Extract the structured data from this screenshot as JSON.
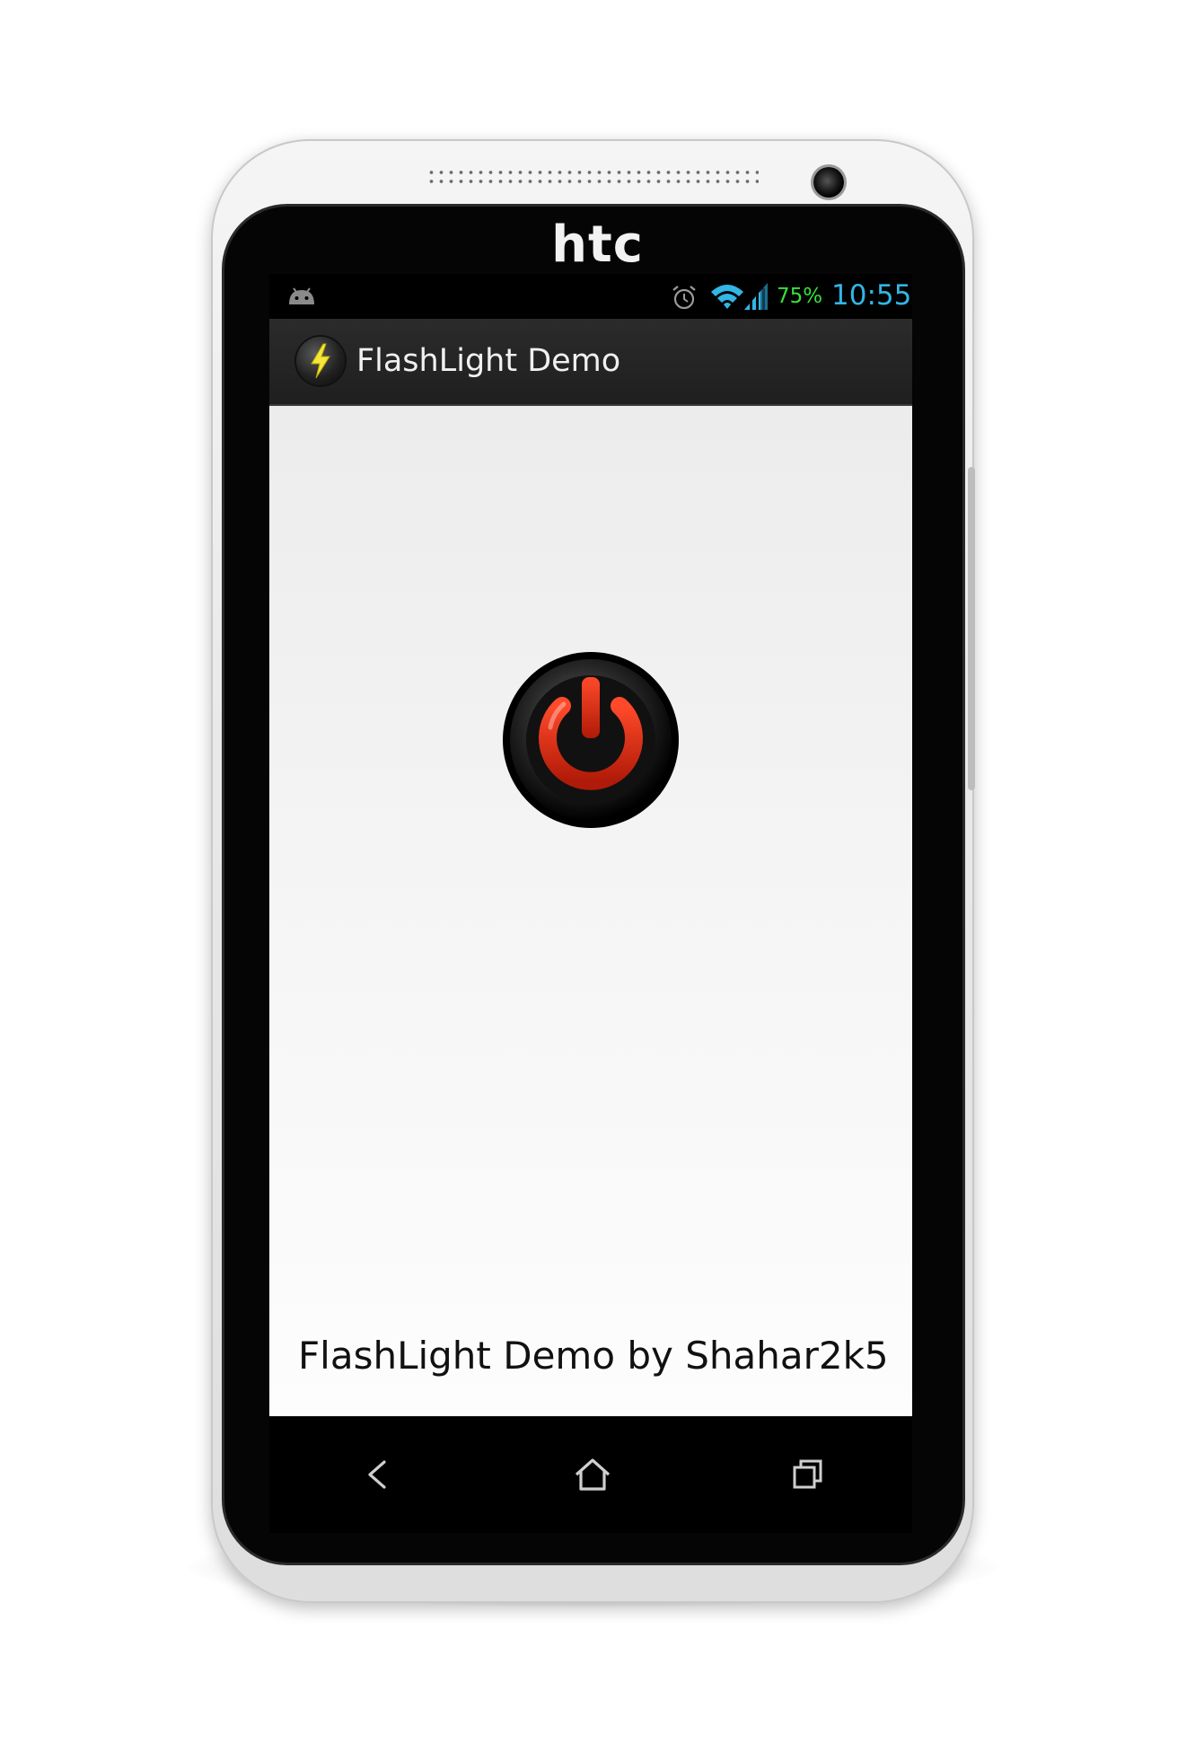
{
  "device": {
    "brand": "htc"
  },
  "status_bar": {
    "notification_icon": "android-icon",
    "alarm_icon": "alarm-clock-icon",
    "wifi_icon": "wifi-icon",
    "signal_icon": "signal-bars-icon",
    "battery_percent": "75%",
    "time": "10:55",
    "colors": {
      "battery": "#36e036",
      "clock": "#33b5e5"
    }
  },
  "action_bar": {
    "app_icon": "lightning-bolt-icon",
    "title": "FlashLight Demo"
  },
  "main": {
    "power_button_icon": "power-icon",
    "power_color": "#d42a14",
    "footer_text": "FlashLight Demo by Shahar2k5"
  },
  "nav_bar": {
    "back_icon": "back-arrow-icon",
    "home_icon": "home-icon",
    "recent_icon": "recent-apps-icon"
  }
}
